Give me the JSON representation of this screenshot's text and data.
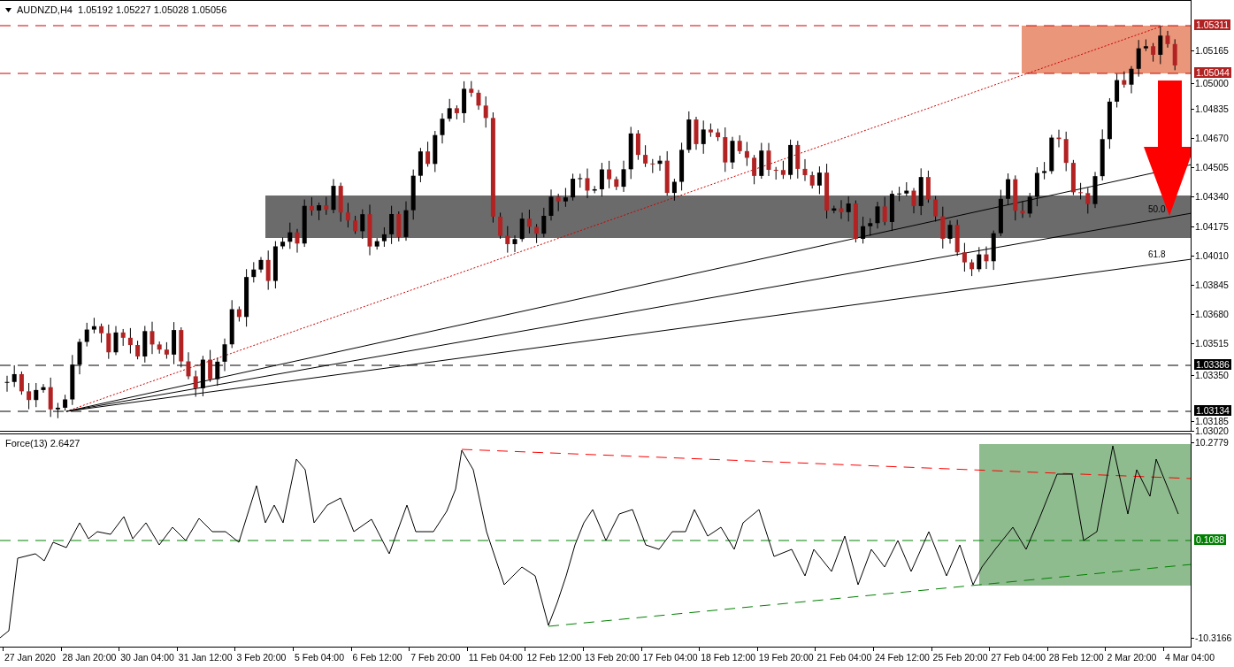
{
  "main_chart": {
    "header": "AUDNZD,H4  1.05192 1.05227 1.05028 1.05056",
    "fan_labels": [
      "50.0",
      "61.8"
    ],
    "price_ticks": [
      "1.05165",
      "1.05000",
      "1.04835",
      "1.04670",
      "1.04505",
      "1.04340",
      "1.04175",
      "1.04010",
      "1.03845",
      "1.03680",
      "1.03515",
      "1.03350",
      "1.03185",
      "1.03020"
    ],
    "level_labels": [
      {
        "text": "1.05311",
        "color": "#b22222"
      },
      {
        "text": "1.05044",
        "color": "#b22222"
      },
      {
        "text": "1.03386",
        "color": "#000000"
      },
      {
        "text": "1.03134",
        "color": "#000000"
      }
    ]
  },
  "force_chart": {
    "header": "Force(13) 2.6427",
    "axis_ticks": [
      "10.2779",
      "-10.3166"
    ],
    "level_label": {
      "text": "0.1088",
      "color": "#008000"
    }
  },
  "time_axis": [
    "27 Jan 2020",
    "28 Jan 20:00",
    "30 Jan 04:00",
    "31 Jan 12:00",
    "3 Feb 20:00",
    "5 Feb 04:00",
    "6 Feb 12:00",
    "7 Feb 20:00",
    "11 Feb 04:00",
    "12 Feb 12:00",
    "13 Feb 20:00",
    "17 Feb 04:00",
    "18 Feb 12:00",
    "19 Feb 20:00",
    "21 Feb 04:00",
    "24 Feb 12:00",
    "25 Feb 20:00",
    "27 Feb 04:00",
    "28 Feb 12:00",
    "2 Mar 20:00",
    "4 Mar 04:00"
  ]
}
